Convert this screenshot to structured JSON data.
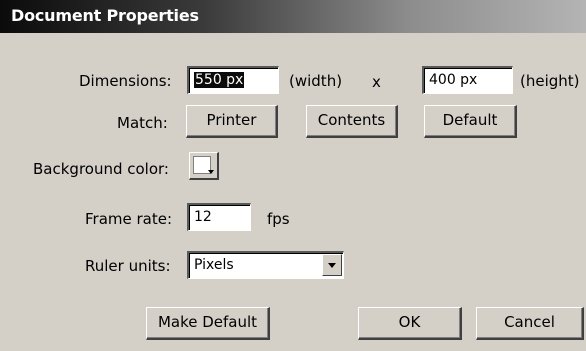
{
  "window": {
    "title": "Document Properties"
  },
  "dimensions": {
    "label": "Dimensions:",
    "width_value": "550 px",
    "width_unit": "(width)",
    "separator": "x",
    "height_value": "400 px",
    "height_unit": "(height)"
  },
  "match": {
    "label": "Match:",
    "printer": "Printer",
    "contents": "Contents",
    "default": "Default"
  },
  "background": {
    "label": "Background color:",
    "color": "#ffffff"
  },
  "frame_rate": {
    "label": "Frame rate:",
    "value": "12",
    "unit": "fps"
  },
  "ruler_units": {
    "label": "Ruler units:",
    "selected": "Pixels"
  },
  "footer": {
    "make_default": "Make Default",
    "ok": "OK",
    "cancel": "Cancel"
  }
}
